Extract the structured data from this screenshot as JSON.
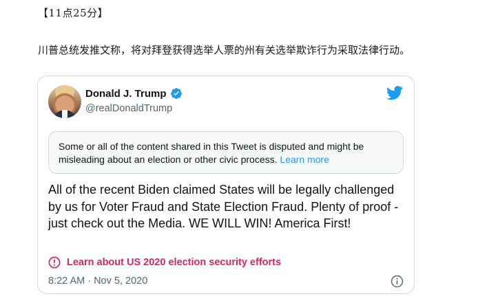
{
  "header": {
    "time": "【11点25分】"
  },
  "intro": {
    "text": "川普总统发推文称，将对拜登获得选举人票的州有关选举欺诈行为采取法律行动。"
  },
  "tweet": {
    "display_name": "Donald J. Trump",
    "handle": "@realDonaldTrump",
    "notice": {
      "text": "Some or all of the content shared in this Tweet is disputed and might be misleading about an election or other civic process.",
      "link": "Learn more"
    },
    "body": "All of the recent Biden claimed States will be legally challenged by us for Voter Fraud and State Election Fraud. Plenty of proof - just check out the Media. WE WILL WIN! America First!",
    "election_link": "Learn about US 2020 election security efforts",
    "timestamp": "8:22 AM · Nov 5, 2020"
  },
  "colors": {
    "twitter_blue": "#1d9bf0",
    "election_red": "#d6265f",
    "muted_text": "#536471",
    "border": "#cfd9de"
  },
  "icons": {
    "verified": "verified-badge-icon",
    "bird": "twitter-bird-icon",
    "alert": "alert-circle-icon",
    "info": "info-icon"
  }
}
